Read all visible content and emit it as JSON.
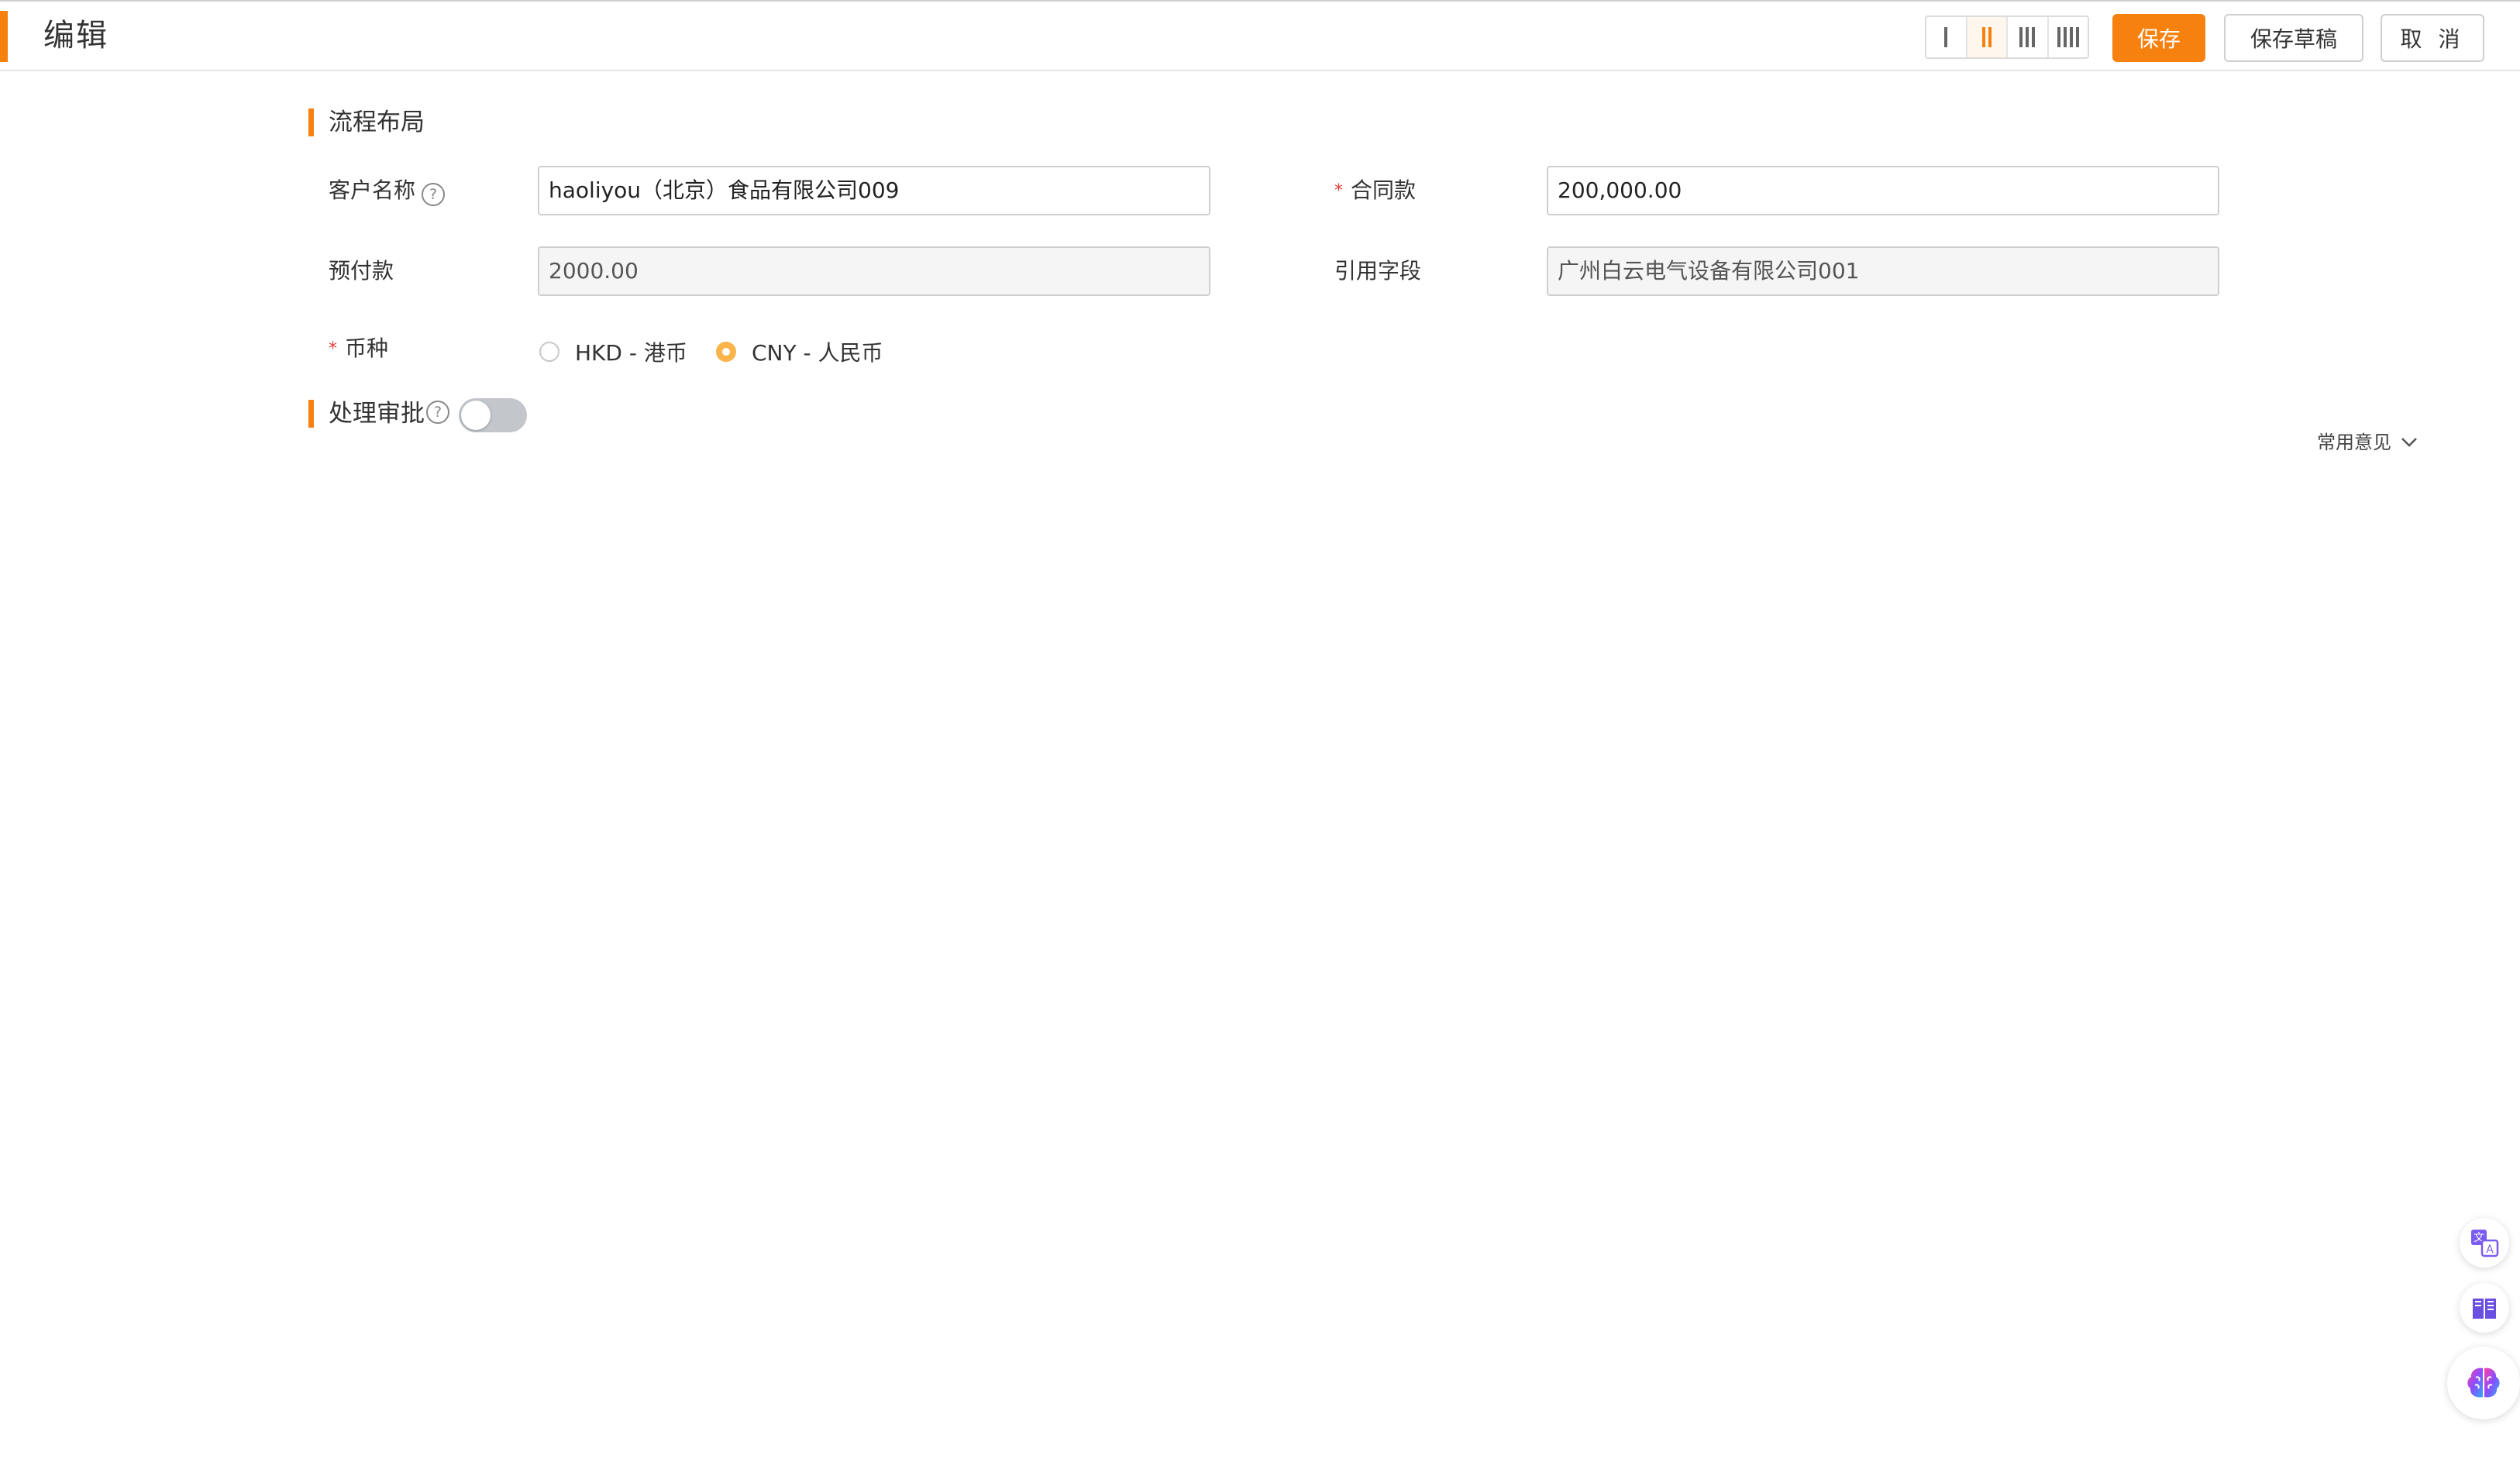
{
  "header": {
    "title": "编辑",
    "save_label": "保存",
    "save_draft_label": "保存草稿",
    "cancel_label": "取 消",
    "layout_options": [
      "1 column",
      "2 columns",
      "3 columns",
      "4 columns"
    ],
    "active_layout": "2 columns"
  },
  "colors": {
    "accent": "#f7810f",
    "radio_checked": "#f9b44a",
    "required": "#e53935",
    "toggle_off": "#c3c6cb"
  },
  "section_flow": {
    "title": "流程布局",
    "fields": {
      "customer_name": {
        "label": "客户名称",
        "value": "haoliyou（北京）食品有限公司009",
        "help": "?"
      },
      "contract_amount": {
        "label": "合同款",
        "required_mark": "*",
        "value": "200,000.00"
      },
      "prepayment": {
        "label": "预付款",
        "value": "2000.00"
      },
      "reference_field": {
        "label": "引用字段",
        "value": "广州白云电气设备有限公司001"
      },
      "currency": {
        "label": "币种",
        "required_mark": "*",
        "options": [
          "HKD - 港币",
          "CNY - 人民币"
        ],
        "selected": "CNY - 人民币"
      }
    }
  },
  "section_approval": {
    "title": "处理审批",
    "help": "?",
    "toggle_on": false,
    "common_opinion_label": "常用意见"
  },
  "floating_tools": [
    "translate-icon",
    "book-icon",
    "brain-icon"
  ]
}
